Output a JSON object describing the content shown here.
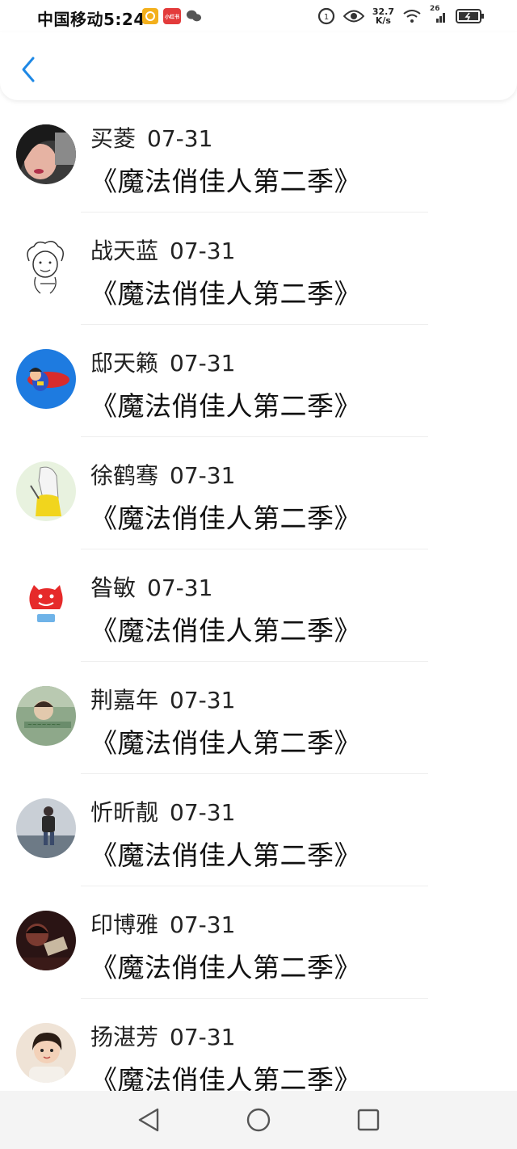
{
  "status_bar": {
    "carrier_time": "中国移动5:24",
    "notif_red_label": "小红书",
    "speed_value": "32.7",
    "speed_unit": "K/s",
    "network": "26"
  },
  "header": {
    "back_icon": "chevron-left-icon",
    "accent_color": "#1e88e5"
  },
  "comments": [
    {
      "name": "买菱",
      "date": "07-31",
      "text": "《魔法俏佳人第二季》",
      "avatar": "girl-photo"
    },
    {
      "name": "战天蓝",
      "date": "07-31",
      "text": "《魔法俏佳人第二季》",
      "avatar": "sketch-character"
    },
    {
      "name": "邸天籁",
      "date": "07-31",
      "text": "《魔法俏佳人第二季》",
      "avatar": "superman-cartoon"
    },
    {
      "name": "徐鹤骞",
      "date": "07-31",
      "text": "《魔法俏佳人第二季》",
      "avatar": "yellow-girl-drawing"
    },
    {
      "name": "昝敏",
      "date": "07-31",
      "text": "《魔法俏佳人第二季》",
      "avatar": "red-cartoon"
    },
    {
      "name": "荆嘉年",
      "date": "07-31",
      "text": "《魔法俏佳人第二季》",
      "avatar": "boy-photo"
    },
    {
      "name": "忻昕靓",
      "date": "07-31",
      "text": "《魔法俏佳人第二季》",
      "avatar": "walking-person"
    },
    {
      "name": "印博雅",
      "date": "07-31",
      "text": "《魔法俏佳人第二季》",
      "avatar": "dark-photo"
    },
    {
      "name": "扬湛芳",
      "date": "07-31",
      "text": "《魔法俏佳人第二季》",
      "avatar": "child-photo"
    }
  ],
  "nav": {
    "back": "triangle-back-icon",
    "home": "circle-home-icon",
    "recents": "square-recents-icon"
  }
}
